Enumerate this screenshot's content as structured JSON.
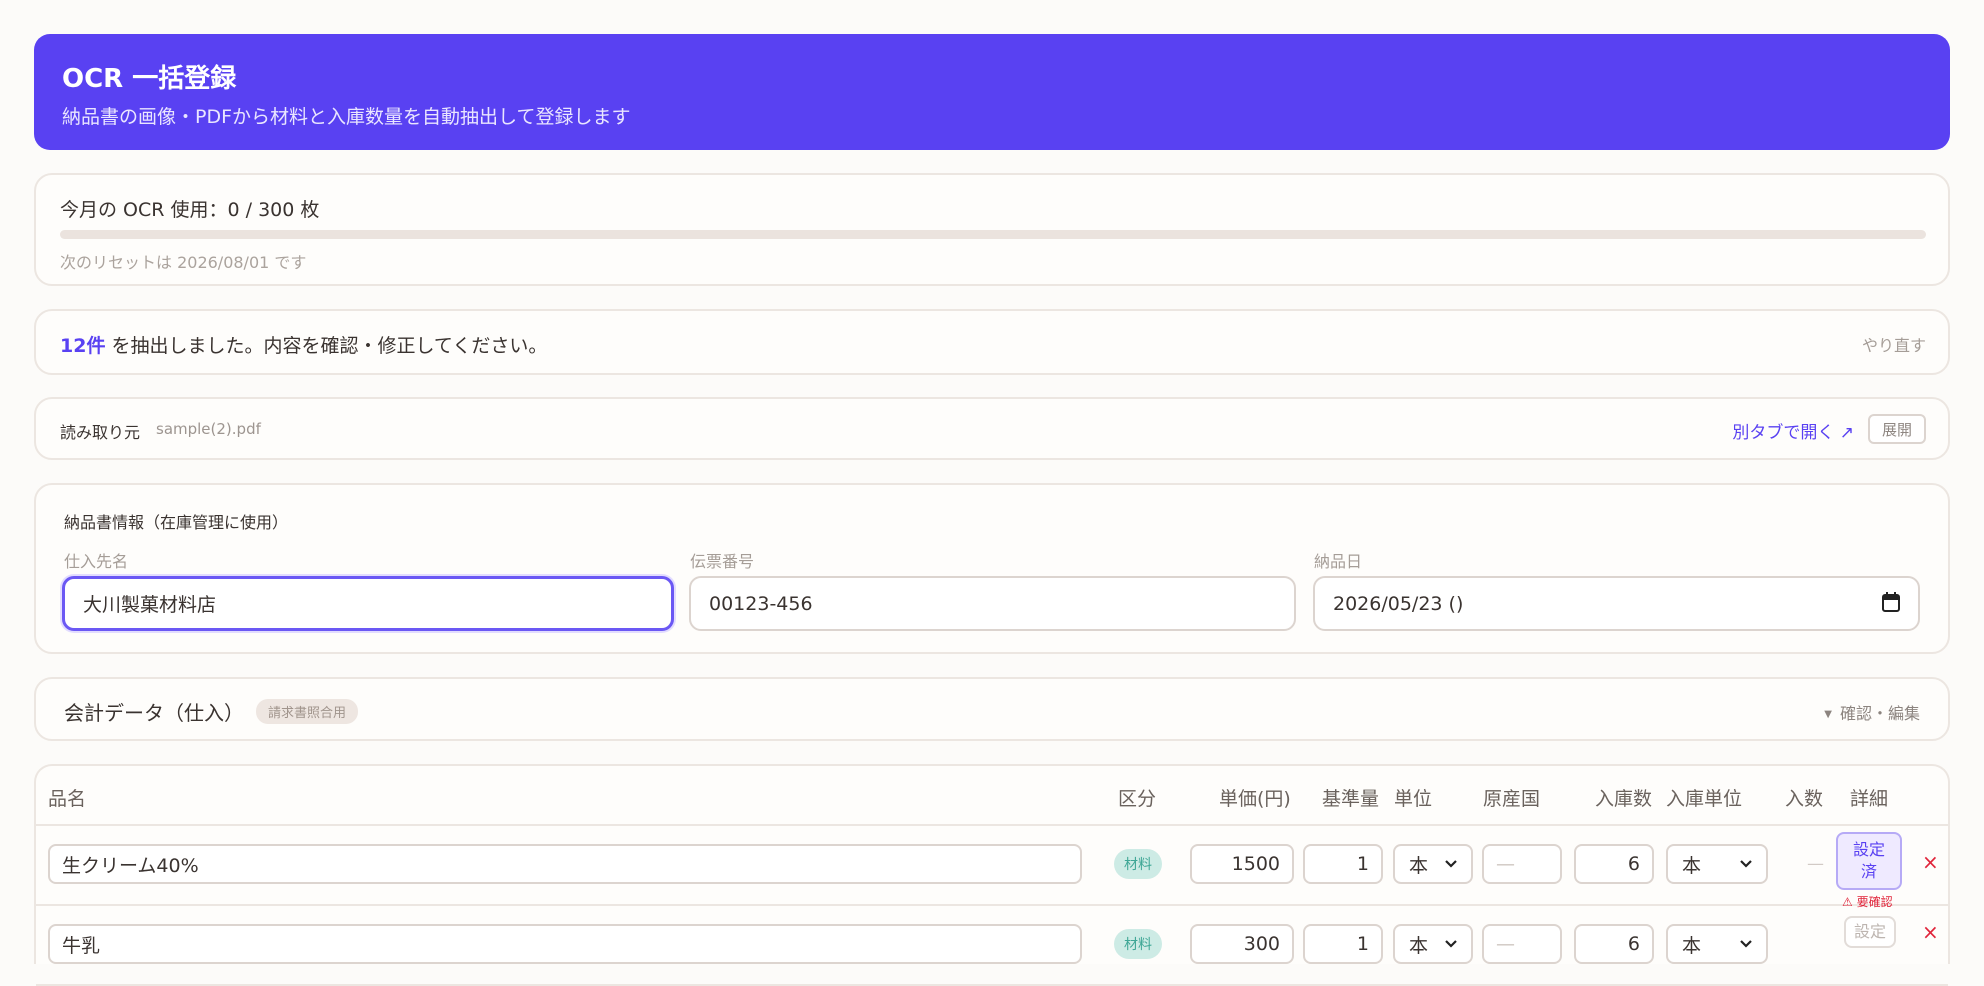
{
  "header": {
    "title": "OCR 一括登録",
    "subtitle": "納品書の画像・PDFから材料と入庫数量を自動抽出して登録します"
  },
  "usage": {
    "label": "今月の OCR 使用：0 / 300 枚",
    "used": 0,
    "limit": 300,
    "reset_text": "次のリセットは 2026/08/01 です"
  },
  "summary": {
    "count": "12件",
    "message": " を抽出しました。内容を確認・修正してください。",
    "retry": "やり直す"
  },
  "source": {
    "label": "読み取り元",
    "file": "sample(2).pdf",
    "open_link": "別タブで開く ↗",
    "expand": "展開"
  },
  "invoice": {
    "section_title": "納品書情報（在庫管理に使用）",
    "supplier_label": "仕入先名",
    "supplier_value": "大川製菓材料店",
    "slip_label": "伝票番号",
    "slip_value": "00123-456",
    "date_label": "納品日",
    "date_value": "2026/05/23 ()"
  },
  "accounting": {
    "title": "会計データ（仕入）",
    "badge": "請求書照合用",
    "toggle": "確認・編集"
  },
  "table": {
    "headers": {
      "name": "品名",
      "category": "区分",
      "unit_price": "単価(円)",
      "base_qty": "基準量",
      "unit": "単位",
      "origin": "原産国",
      "qty": "入庫数",
      "stock_unit": "入庫単位",
      "pack": "入数",
      "detail": "詳細"
    },
    "rows": [
      {
        "name": "生クリーム40%",
        "category": "材料",
        "unit_price": "1500",
        "base_qty": "1",
        "unit": "本",
        "origin": "—",
        "qty": "6",
        "stock_unit": "本",
        "pack": "—",
        "detail_line1": "設定",
        "detail_line2": "済",
        "warning": "⚠ 要確認",
        "delete": "×"
      },
      {
        "name": "牛乳",
        "category": "材料",
        "unit_price": "300",
        "base_qty": "1",
        "unit": "本",
        "origin": "—",
        "qty": "6",
        "stock_unit": "本",
        "detail": "設定",
        "delete": "×"
      }
    ]
  },
  "colors": {
    "accent": "#5941f2",
    "danger": "#e0243a",
    "tag_bg": "#cdebe5",
    "tag_text": "#3fa796"
  }
}
